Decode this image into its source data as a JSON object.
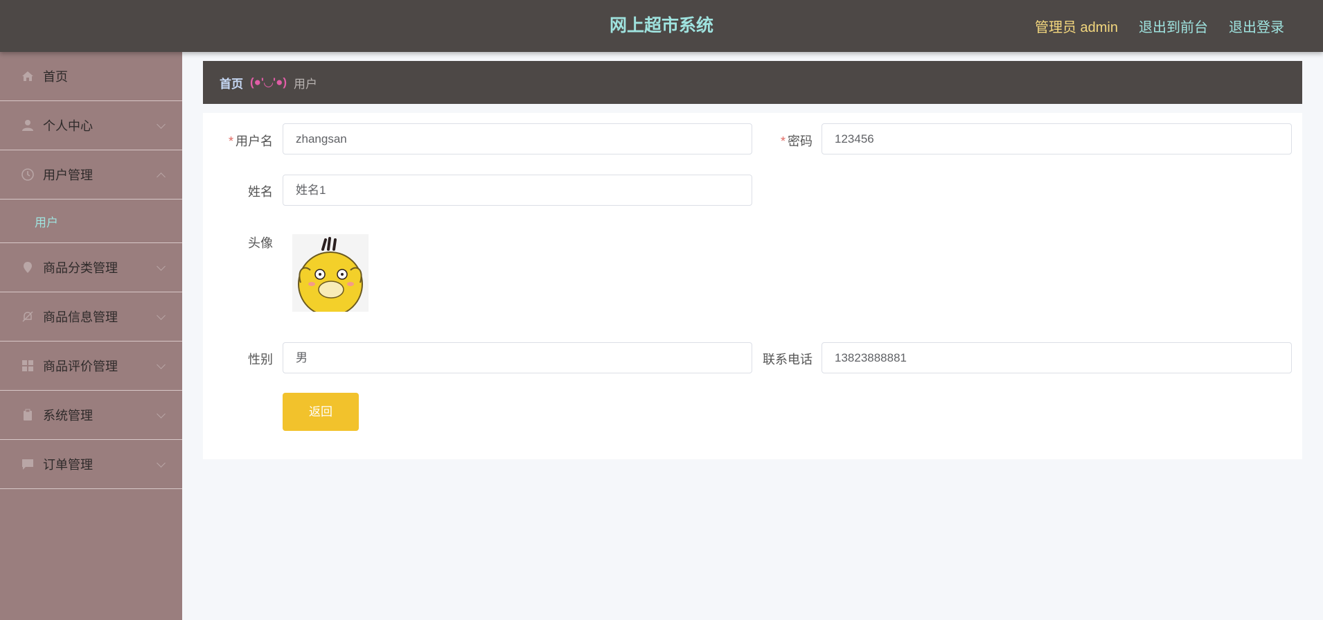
{
  "header": {
    "title": "网上超市系统",
    "admin_label": "管理员 admin",
    "links": [
      "退出到前台",
      "退出登录"
    ]
  },
  "sidebar": {
    "items": [
      {
        "label": "首页",
        "icon": "home-icon",
        "expandable": false
      },
      {
        "label": "个人中心",
        "icon": "user-icon",
        "expandable": true
      },
      {
        "label": "用户管理",
        "icon": "clock-icon",
        "expandable": true,
        "expanded": true,
        "children": [
          "用户"
        ]
      },
      {
        "label": "商品分类管理",
        "icon": "location-pin-icon",
        "expandable": true
      },
      {
        "label": "商品信息管理",
        "icon": "no-bell-icon",
        "expandable": true
      },
      {
        "label": "商品评价管理",
        "icon": "grid-icon",
        "expandable": true
      },
      {
        "label": "系统管理",
        "icon": "clipboard-icon",
        "expandable": true
      },
      {
        "label": "订单管理",
        "icon": "message-icon",
        "expandable": true
      }
    ]
  },
  "breadcrumb": {
    "home": "首页",
    "separator": "(●'◡'●)",
    "current": "用户"
  },
  "form": {
    "username": {
      "label": "用户名",
      "value": "zhangsan",
      "required": true
    },
    "password": {
      "label": "密码",
      "value": "123456",
      "required": true
    },
    "name": {
      "label": "姓名",
      "value": "姓名1"
    },
    "avatar": {
      "label": "头像",
      "icon": "duck-avatar-image"
    },
    "gender": {
      "label": "性别",
      "value": "男"
    },
    "phone": {
      "label": "联系电话",
      "value": "13823888881"
    },
    "back_button": "返回"
  },
  "colors": {
    "header_bg": "#4d4846",
    "title": "#9fe3df",
    "admin": "#f3d77e",
    "sidebar_bg": "#9a7e7e",
    "button": "#f2c22c"
  }
}
